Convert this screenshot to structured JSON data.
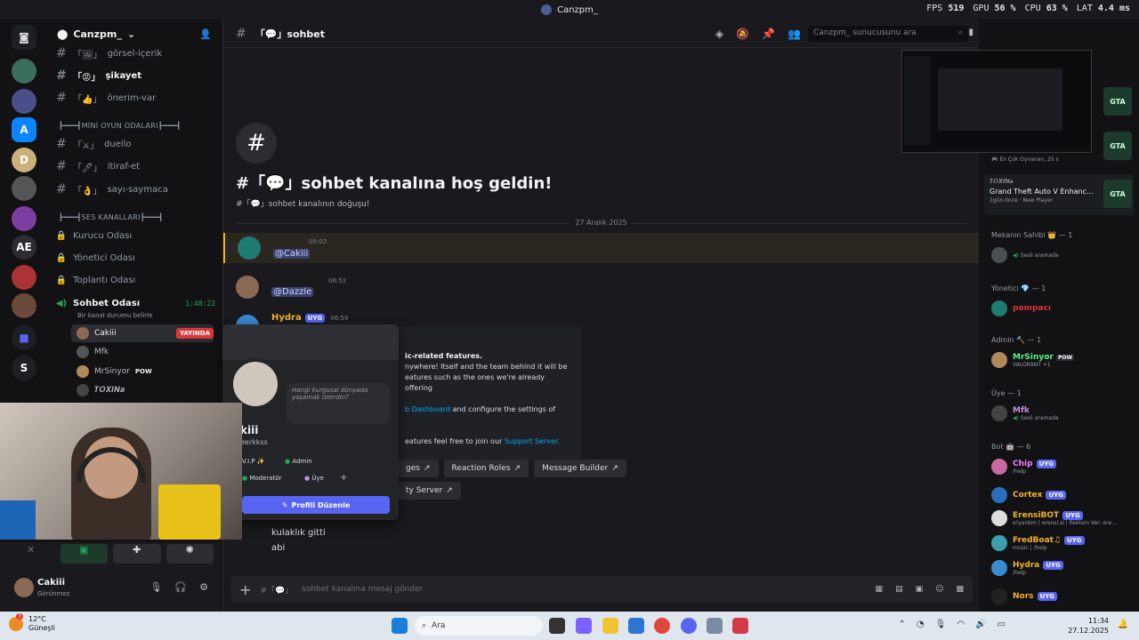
{
  "window": {
    "title": "Canzpm_"
  },
  "stats": {
    "fps_label": "FPS",
    "fps": "519",
    "gpu_label": "GPU",
    "gpu": "56 %",
    "cpu_label": "CPU",
    "cpu": "63 %",
    "lat_label": "LAT",
    "lat": "4.4 ms"
  },
  "server": {
    "name": "Canzpm_"
  },
  "channels": [
    {
      "name": "görsel-içerik",
      "emoji": "🖼"
    },
    {
      "name": "şikayet",
      "emoji": "😡",
      "bold": true
    },
    {
      "name": "önerim-var",
      "emoji": "👍"
    },
    {
      "name": "duello",
      "emoji": "⚔"
    },
    {
      "name": "itiraf-et",
      "emoji": "🖊"
    },
    {
      "name": "sayı-saymaca",
      "emoji": "👌"
    }
  ],
  "categories": {
    "games": "┣━━━┫MİNİ OYUN ODALARI┣━━━┫",
    "voice": "┣━━━┫SES KANALLARI┣━━━┫"
  },
  "voice_channels": [
    "Kurucu Odası",
    "Yönetici Odası",
    "Toplantı Odası",
    "Sohbet Odası"
  ],
  "voice_active": {
    "name": "Sohbet Odası",
    "timer": "1:48:23",
    "status_hint": "Bir kanal durumu belirle"
  },
  "voice_users": [
    {
      "name": "Cakiii",
      "live": "YAYINDA"
    },
    {
      "name": "Mfk"
    },
    {
      "name": "MrSinyor",
      "tag": "POW"
    },
    {
      "name": "𝑻𝑶𝑿𝑰𝑵𝒂"
    }
  ],
  "channel_header": {
    "name": "sohbet",
    "search_placeholder": "Canzpm_ sunucusunu ara"
  },
  "welcome": {
    "title": "#「💬」sohbet kanalına hoş geldin!",
    "subtitle": "#「💬」sohbet kanalının doğuşu!"
  },
  "date_divider": "27 Aralık 2025",
  "messages": [
    {
      "author": "",
      "time": "00:02",
      "mention": "@Cakiii"
    },
    {
      "author": "",
      "time": "06:52",
      "mention": "@Dazzle"
    },
    {
      "author": "Hydra",
      "tag": "UYG",
      "time": "06:59"
    }
  ],
  "embed": {
    "line1": "ic-related features.",
    "line2": "nywhere! Itself and the team behind it will be",
    "line3": "eatures such as the ones we're already offering",
    "line4a": "b Dashboard",
    "line4b": " and configure the settings of",
    "line5a": "eatures feel free to join our ",
    "line5b": "Support Server."
  },
  "link_buttons": [
    "ges",
    "Reaction Roles",
    "Message Builder",
    "ty Server"
  ],
  "last_messages": [
    "kulaklık gitti",
    "abi"
  ],
  "composer": {
    "placeholder": "sohbet kanalına mesaj gönder"
  },
  "profile_popup": {
    "status_text": "Hangi kurgusal dünyada yaşamak isterdin?",
    "name": "kiii",
    "username": "eerkkss",
    "roles": [
      "V.I.P ✨",
      "Admin",
      "Moderatör",
      "Üye"
    ],
    "edit_button": "Profili Düzenle"
  },
  "user_panel": {
    "name": "Cakiii",
    "status": "Görünmez"
  },
  "activity": {
    "most_played": "En Çok Oynanan, 25 s",
    "game_title": "Grand Theft Auto V Enhanc...",
    "game_meta": "1gün önce",
    "game_player": "New Player",
    "game_owner": "𝑻𝑶𝑿𝑰𝑵𝒂"
  },
  "members": [
    {
      "group": "Mekanın Sahibi 👑 — 1"
    },
    {
      "name": "",
      "status": "Sesli aramada",
      "color": "#c9cdfb"
    },
    {
      "group": "Yönetici 💎 — 1"
    },
    {
      "name": "pompacı",
      "status": "",
      "color": "#da373c"
    },
    {
      "group": "Admin 🔨 — 1"
    },
    {
      "name": "MrSinyor",
      "tag": "POW",
      "status": "VALORANT +1",
      "color": "#57f287"
    },
    {
      "group": "Üye — 1"
    },
    {
      "name": "Mfk",
      "status": "Sesli aramada",
      "color": "#c08fe0"
    },
    {
      "group": "Bot 🤖 — 6"
    },
    {
      "name": "Chip",
      "tag": "UYG",
      "status": "/help",
      "color": "#f47fff"
    },
    {
      "name": "Cortex",
      "tag": "UYG",
      "status": "",
      "color": "#f0b132"
    },
    {
      "name": "ErensiBOT",
      "tag": "UYG",
      "status": "e!yardım | erensi.si | Reklam Ver: ere...",
      "color": "#f0b132"
    },
    {
      "name": "FredBoat♫",
      "tag": "UYG",
      "status": "music | /help",
      "color": "#f0b132"
    },
    {
      "name": "Hydra",
      "tag": "UYG",
      "status": "/help",
      "color": "#f0b132"
    },
    {
      "name": "Nors",
      "tag": "UYG",
      "status": "",
      "color": "#f0b132"
    }
  ],
  "taskbar": {
    "weather_temp": "12°C",
    "weather_desc": "Güneşli",
    "search": "Ara",
    "time": "11:34",
    "date": "27.12.2025",
    "weather_badge": "3"
  },
  "colors": {
    "accent": "#5865f2",
    "live": "#da373c",
    "online": "#23a55a"
  }
}
